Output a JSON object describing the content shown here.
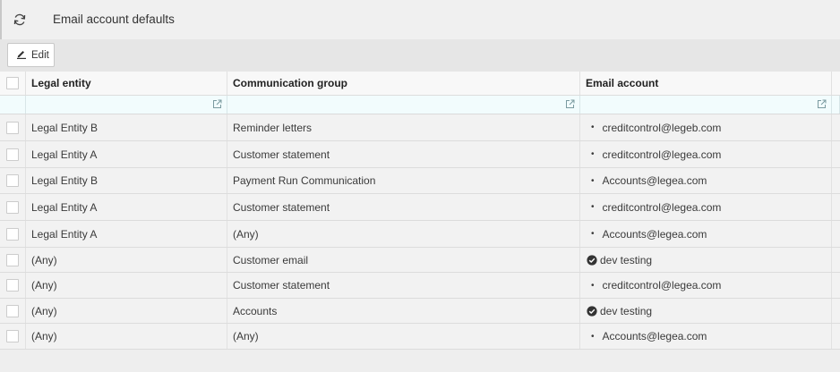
{
  "page": {
    "title": "Email account defaults"
  },
  "toolbar": {
    "edit_label": "Edit"
  },
  "grid": {
    "columns": [
      "Legal entity",
      "Communication group",
      "Email account"
    ],
    "rows": [
      {
        "entity": "Legal Entity B",
        "group": "Reminder letters",
        "account": "creditcontrol@legeb.com",
        "marker": "bullet"
      },
      {
        "entity": "Legal Entity A",
        "group": "Customer statement",
        "account": "creditcontrol@legea.com",
        "marker": "bullet"
      },
      {
        "entity": "Legal Entity B",
        "group": "Payment Run Communication",
        "account": "Accounts@legea.com",
        "marker": "bullet"
      },
      {
        "entity": "Legal Entity A",
        "group": "Customer statement",
        "account": "creditcontrol@legea.com",
        "marker": "bullet"
      },
      {
        "entity": "Legal Entity A",
        "group": "(Any)",
        "account": "Accounts@legea.com",
        "marker": "bullet"
      },
      {
        "entity": "(Any)",
        "group": "Customer email",
        "account": "dev testing",
        "marker": "check"
      },
      {
        "entity": "(Any)",
        "group": "Customer statement",
        "account": "creditcontrol@legea.com",
        "marker": "bullet"
      },
      {
        "entity": "(Any)",
        "group": "Accounts",
        "account": "dev testing",
        "marker": "check"
      },
      {
        "entity": "(Any)",
        "group": "(Any)",
        "account": "Accounts@legea.com",
        "marker": "bullet"
      }
    ]
  },
  "icons": {
    "refresh": "refresh-icon",
    "edit": "pencil-icon",
    "filter": "open-in-new-icon",
    "check": "check-circle-icon"
  }
}
